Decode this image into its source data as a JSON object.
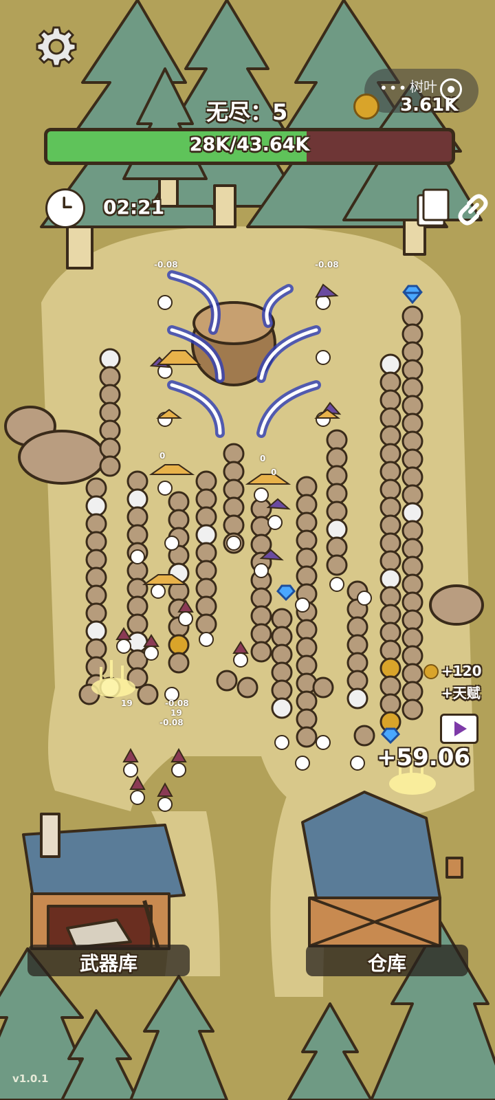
{
  "hud": {
    "mode_label": "无尽：5",
    "hp_text": "28K/43.64K",
    "hp_fraction": 0.6416,
    "timer": "02:21"
  },
  "currency": {
    "name": "树叶",
    "value": "3.61K",
    "menu_dots": "•••"
  },
  "buildings": {
    "weapon_label": "武器库",
    "storage_label": "仓库"
  },
  "rewards": {
    "amount": "+120",
    "talent": "+天赋",
    "income": "+59.06"
  },
  "damage_numbers": [
    "-0.08",
    "-0.08",
    "19",
    "-0.08",
    "19",
    "-0.08",
    "0",
    "0",
    "0"
  ],
  "version": "v1.0.1",
  "colors": {
    "ground": "#b2a159",
    "path": "#d8c88a",
    "tree": "#6f9a84",
    "hp_fill": "#5fc35a",
    "hp_bg": "#6e3636",
    "outline": "#3a2b1a"
  },
  "icons": {
    "settings": "gear-icon",
    "clock": "clock-icon",
    "share": "copy-icon",
    "link": "link-icon",
    "video": "play-icon",
    "coin": "coin-icon"
  }
}
